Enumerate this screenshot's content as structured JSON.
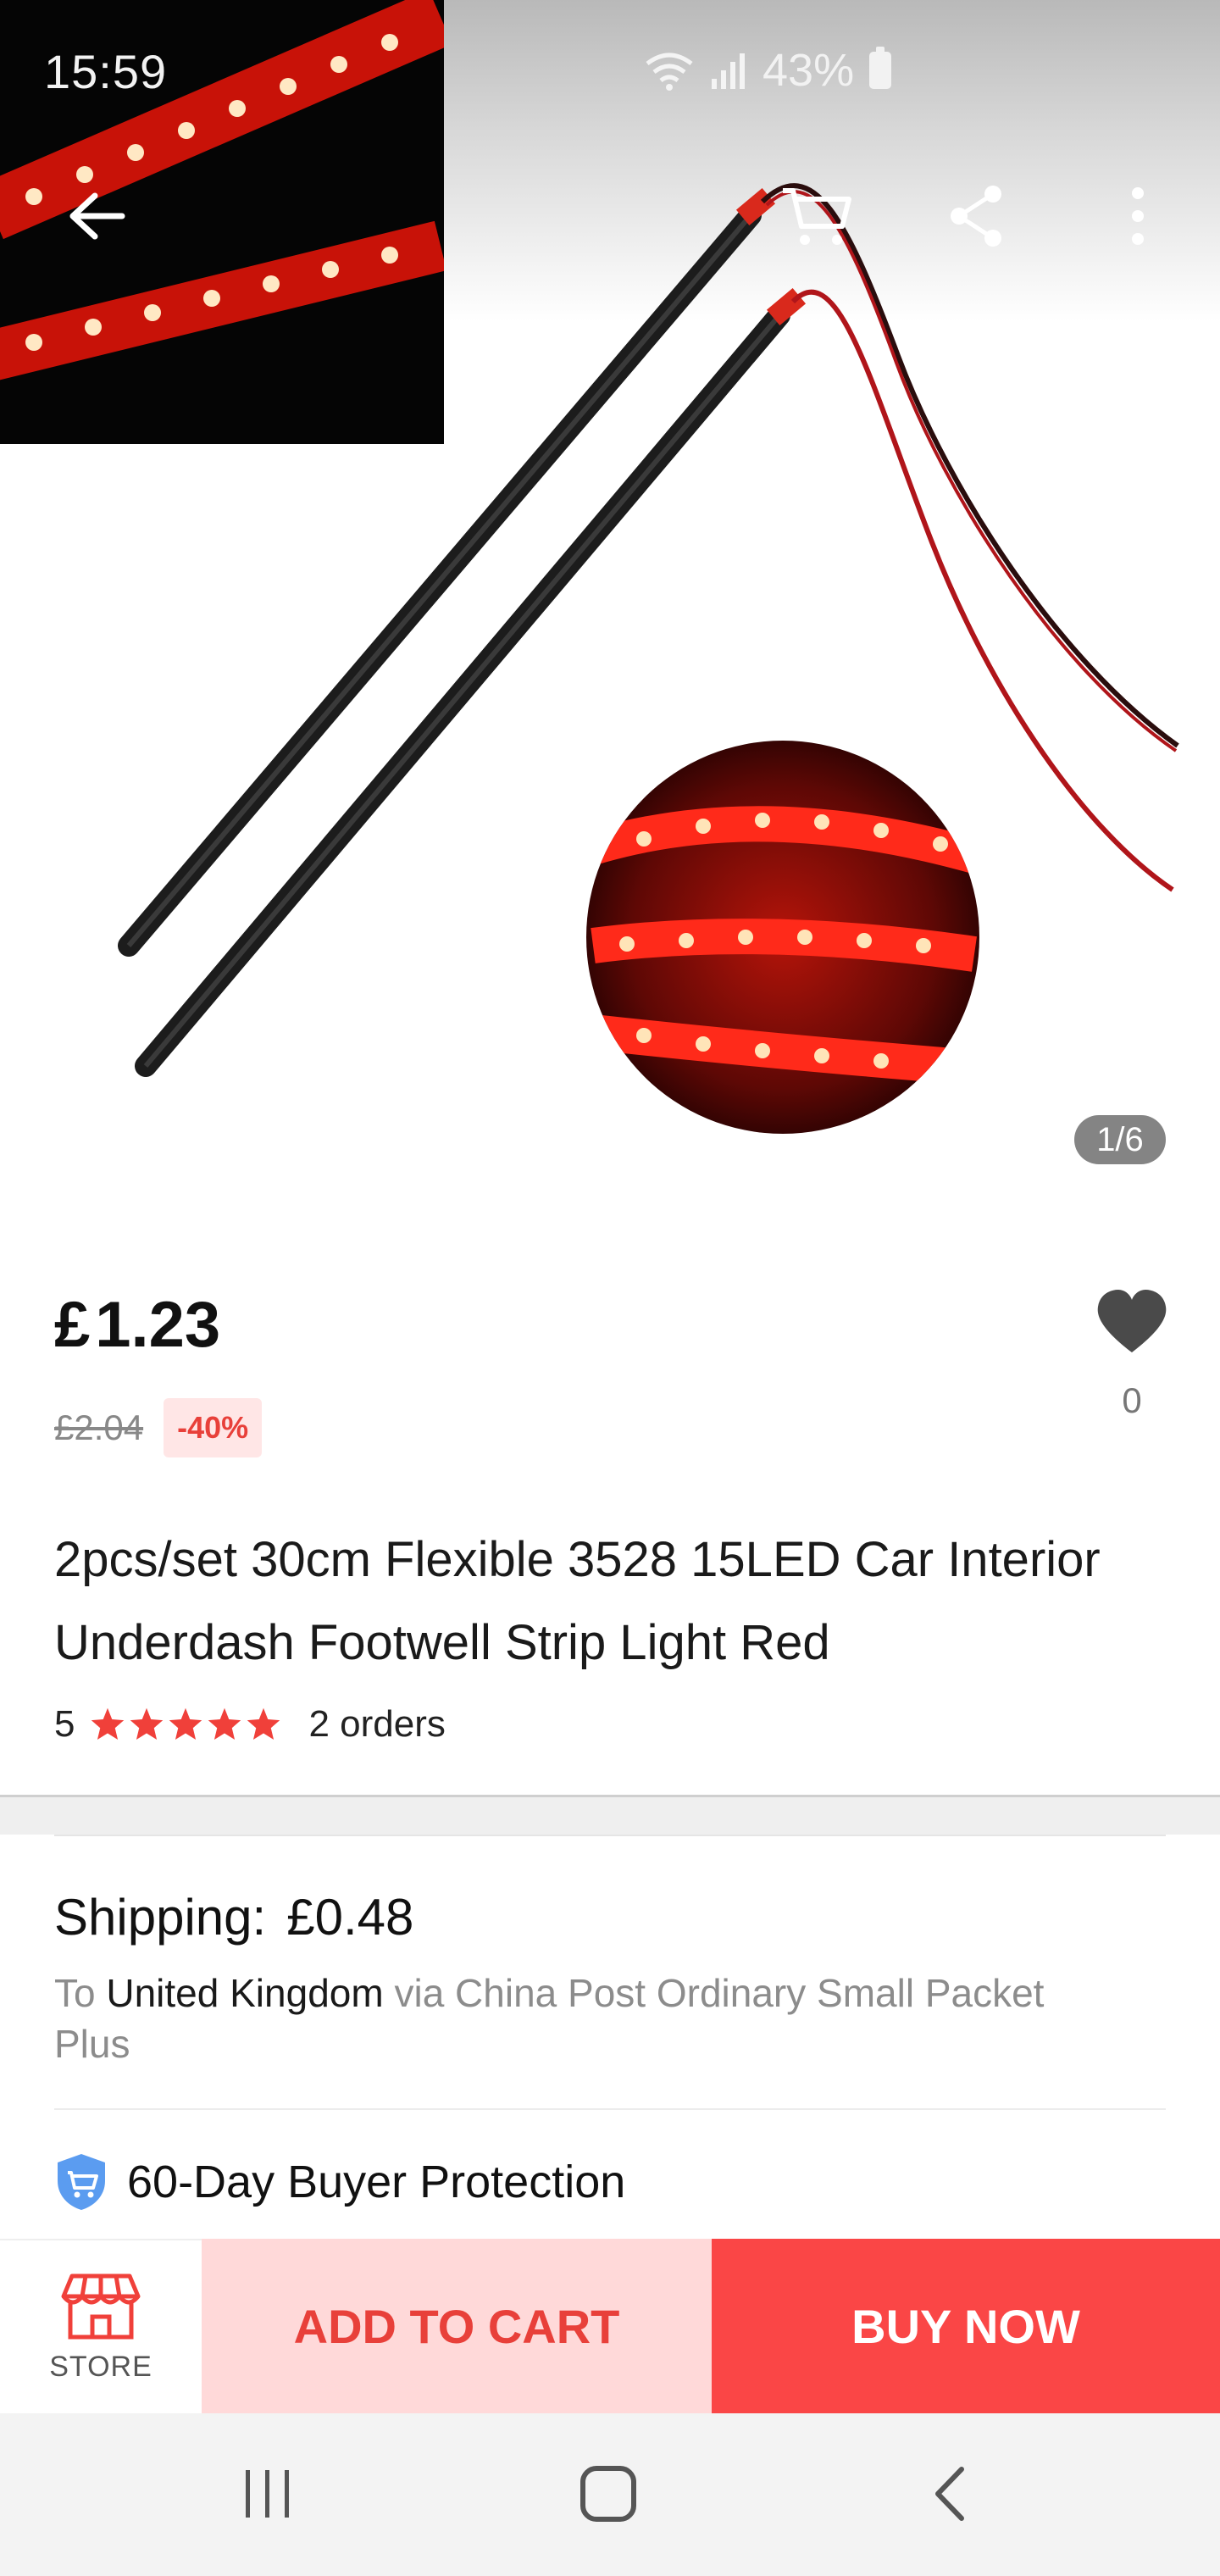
{
  "status_bar": {
    "time": "15:59",
    "battery": "43%"
  },
  "gallery": {
    "counter": "1/6"
  },
  "product": {
    "price_currency": "£",
    "price_now": "1.23",
    "price_old": "£2.04",
    "discount": "-40%",
    "wishlist_count": "0",
    "title": "2pcs/set 30cm Flexible 3528 15LED Car Interior Underdash Footwell Strip Light Red",
    "rating": "5",
    "orders": "2 orders"
  },
  "shipping": {
    "label": "Shipping:",
    "value": "£0.48",
    "to_prefix": "To",
    "country": "United Kingdom",
    "via": "via China Post Ordinary Small Packet Plus"
  },
  "protection": {
    "label": "60-Day Buyer Protection"
  },
  "actions": {
    "store": "STORE",
    "add_to_cart": "ADD TO CART",
    "buy_now": "BUY NOW"
  },
  "colors": {
    "accent": "#fa4646",
    "cart_bg": "#ffd9d9",
    "led_red": "#ff2a1a",
    "shield_blue": "#5b9cf0"
  },
  "icons": [
    "back-arrow-icon",
    "cart-icon",
    "share-icon",
    "more-icon",
    "heart-icon",
    "star-icon",
    "shield-icon",
    "store-icon",
    "recents-icon",
    "home-icon",
    "back-nav-icon"
  ]
}
